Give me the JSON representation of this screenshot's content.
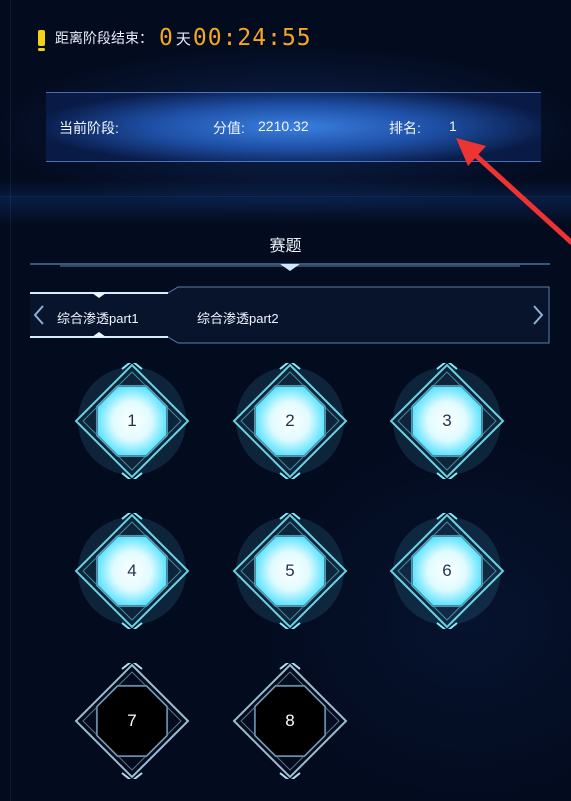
{
  "countdown": {
    "label": "距离阶段结束：",
    "days": "0",
    "days_unit": "天",
    "time": "00:24:55"
  },
  "status": {
    "stage_label": "当前阶段:",
    "score_label": "分值:",
    "score": "2210.32",
    "rank_label": "排名:",
    "rank": "1"
  },
  "section": {
    "title": "赛题"
  },
  "tabs": [
    {
      "label": "综合渗透part1",
      "active": true
    },
    {
      "label": "综合渗透part2",
      "active": false
    }
  ],
  "challenges": [
    {
      "label": "1",
      "state": "lit"
    },
    {
      "label": "2",
      "state": "lit"
    },
    {
      "label": "3",
      "state": "lit"
    },
    {
      "label": "4",
      "state": "lit"
    },
    {
      "label": "5",
      "state": "lit"
    },
    {
      "label": "6",
      "state": "lit"
    },
    {
      "label": "7",
      "state": "dark"
    },
    {
      "label": "8",
      "state": "dark"
    }
  ],
  "colors": {
    "accent_orange": "#f5a623",
    "warn_yellow": "#f1d318",
    "glow_cyan": "#7ff0ff",
    "annotation_red": "#ee3333"
  }
}
